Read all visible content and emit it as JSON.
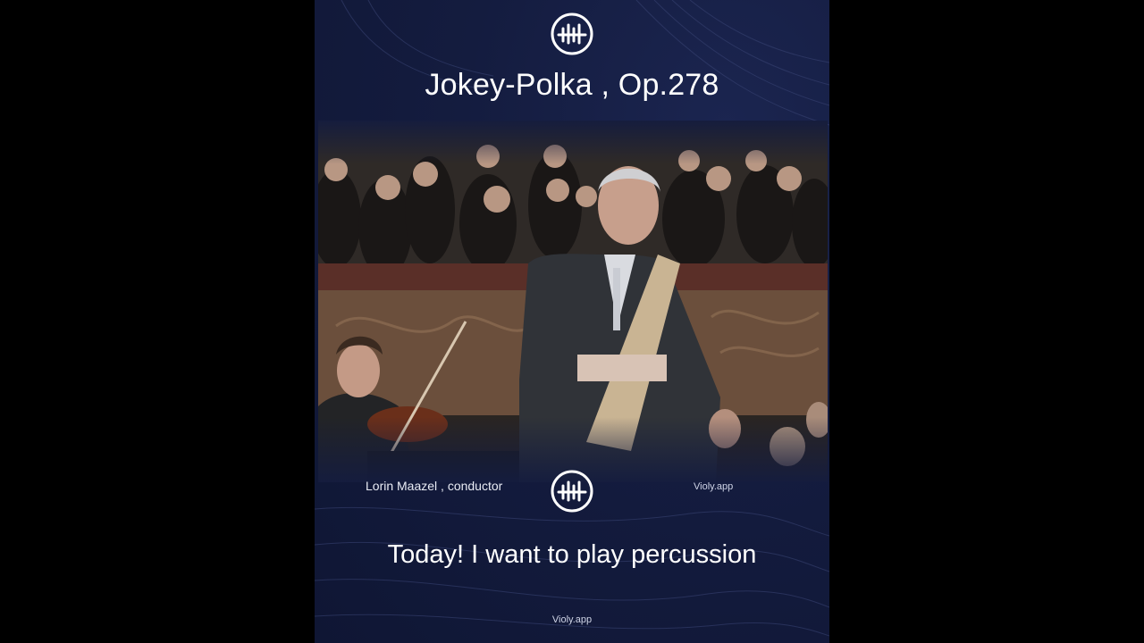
{
  "title": "Jokey-Polka , Op.278",
  "credit": "Lorin Maazel , conductor",
  "subtitle": "Today! I want to play percussion",
  "watermark_mid": "Violy.app",
  "watermark_bottom": "Violy.app",
  "icons": {
    "logo": "violy-logo-icon"
  },
  "colors": {
    "background": "#141c3f",
    "text": "#ffffff"
  }
}
